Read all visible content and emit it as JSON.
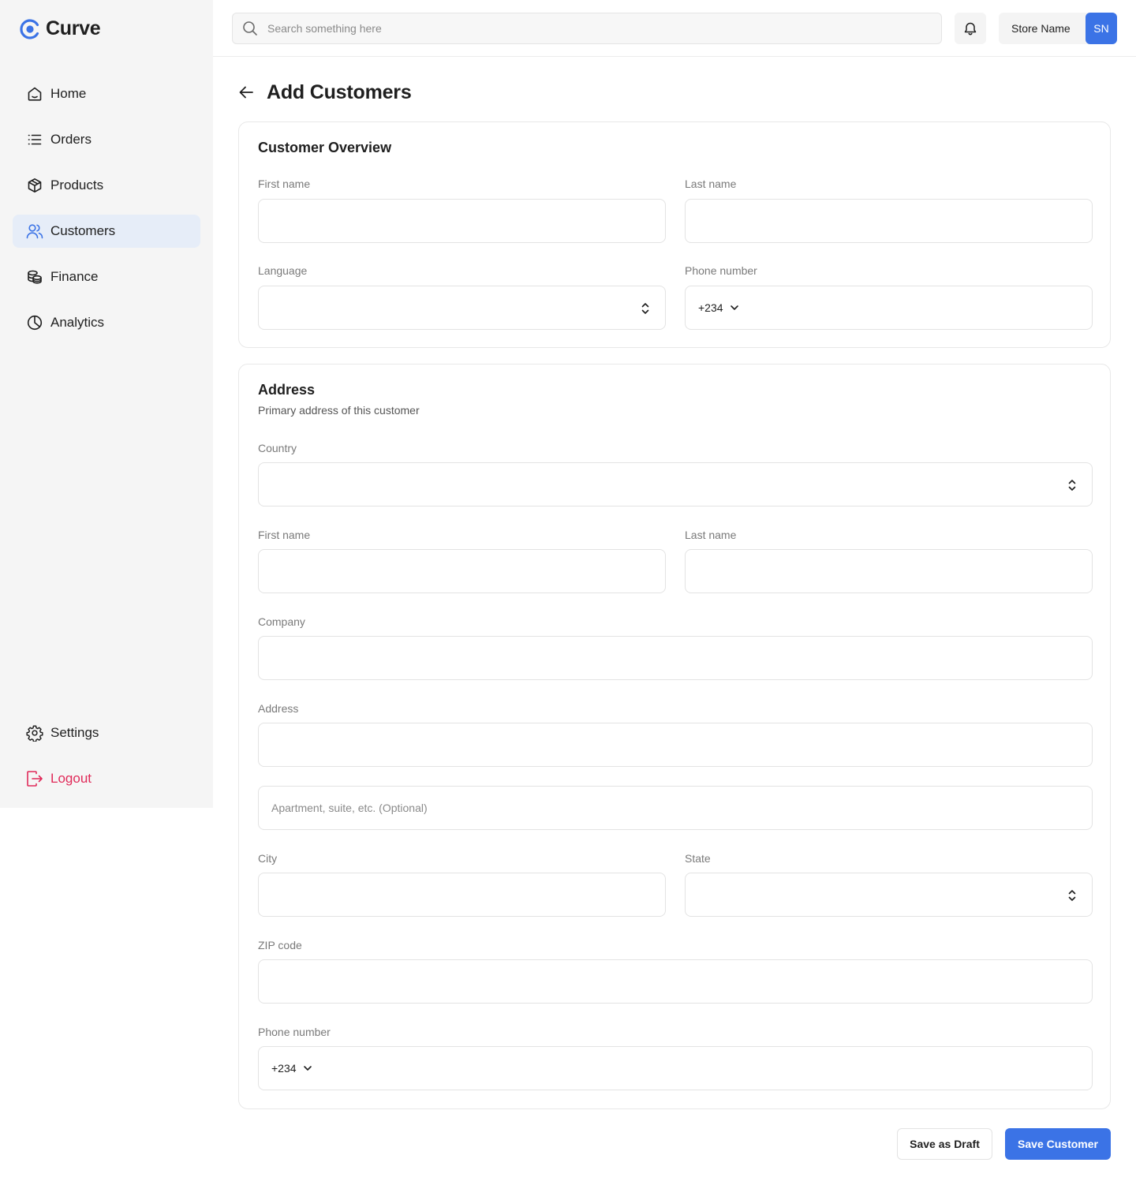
{
  "app": {
    "name": "Curve"
  },
  "sidebar": {
    "items": [
      {
        "label": "Home",
        "icon": "home-icon",
        "active": false
      },
      {
        "label": "Orders",
        "icon": "list-icon",
        "active": false
      },
      {
        "label": "Products",
        "icon": "box-icon",
        "active": false
      },
      {
        "label": "Customers",
        "icon": "users-icon",
        "active": true
      },
      {
        "label": "Finance",
        "icon": "coins-icon",
        "active": false
      },
      {
        "label": "Analytics",
        "icon": "pie-chart-icon",
        "active": false
      }
    ],
    "settings_label": "Settings",
    "logout_label": "Logout"
  },
  "topbar": {
    "search_placeholder": "Search something here",
    "store_name": "Store Name",
    "avatar_initials": "SN"
  },
  "page": {
    "title": "Add Customers"
  },
  "overview": {
    "title": "Customer Overview",
    "first_name_label": "First name",
    "last_name_label": "Last name",
    "language_label": "Language",
    "phone_label": "Phone number",
    "dial_code": "+234"
  },
  "address": {
    "title": "Address",
    "subtitle": "Primary address of this customer",
    "country_label": "Country",
    "first_name_label": "First name",
    "last_name_label": "Last name",
    "company_label": "Company",
    "address_label": "Address",
    "apartment_placeholder": "Apartment, suite, etc. (Optional)",
    "city_label": "City",
    "state_label": "State",
    "zip_label": "ZIP code",
    "phone_label": "Phone number",
    "dial_code": "+234"
  },
  "actions": {
    "draft_label": "Save as Draft",
    "save_label": "Save Customer"
  },
  "colors": {
    "accent": "#3b73e6",
    "active_nav_bg": "#e6edf8",
    "logout": "#e02a59",
    "sidebar_bg": "#f5f5f5"
  }
}
